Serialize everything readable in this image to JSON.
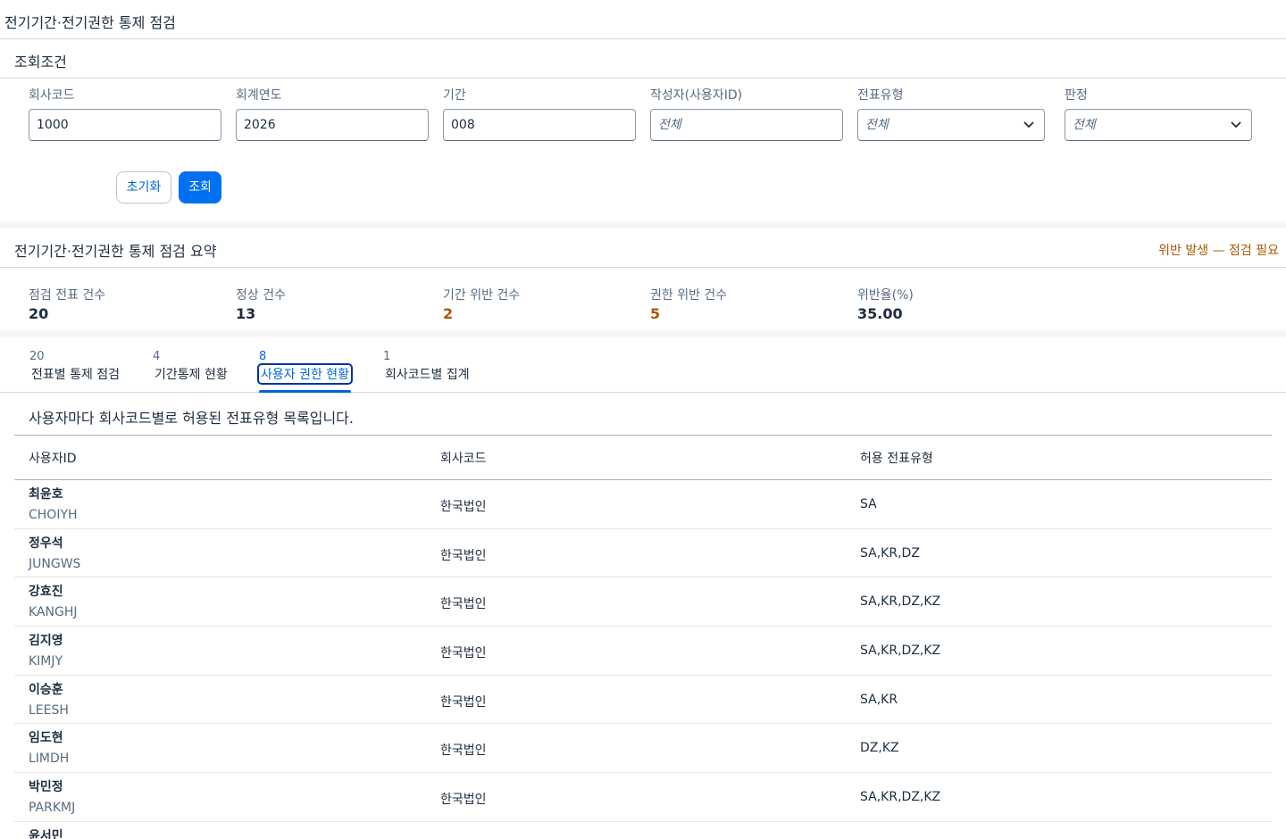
{
  "page": {
    "title": "전기기간·전기권한 통제 점검"
  },
  "filter": {
    "title": "조회조건",
    "fields": [
      {
        "label": "회사코드",
        "value": "1000"
      },
      {
        "label": "회계연도",
        "value": "2026"
      },
      {
        "label": "기간",
        "value": "008"
      },
      {
        "label": "작성자(사용자ID)",
        "placeholder": "전체"
      },
      {
        "label": "전표유형",
        "placeholder": "전체"
      },
      {
        "label": "판정",
        "placeholder": "전체"
      }
    ],
    "reset_label": "초기화",
    "search_label": "조회"
  },
  "summary": {
    "title": "전기기간·전기권한 통제 점검 요약",
    "status": "위반 발생 — 점검 필요",
    "status_color": "#aa5808",
    "kpis": [
      {
        "label": "점검 전표 건수",
        "value": "20"
      },
      {
        "label": "정상 건수",
        "value": "13"
      },
      {
        "label": "기간 위반 건수",
        "value": "2"
      },
      {
        "label": "권한 위반 건수",
        "value": "5"
      },
      {
        "label": "위반율(%)",
        "value": "35.00"
      }
    ]
  },
  "tabs": [
    {
      "count": "20",
      "label": "전표별 통제 점검"
    },
    {
      "count": "4",
      "label": "기간통제 현황"
    },
    {
      "count": "8",
      "label": "사용자 권한 현황"
    },
    {
      "count": "1",
      "label": "회사코드별 집계"
    }
  ],
  "active_tab": 2,
  "user_auth": {
    "description": "사용자마다 회사코드별로 허용된 전표유형 목록입니다.",
    "columns": [
      "사용자ID",
      "회사코드",
      "허용 전표유형"
    ],
    "rows": [
      {
        "name": "최윤호",
        "id": "CHOIYH",
        "company": "한국법인",
        "types": "SA"
      },
      {
        "name": "정우석",
        "id": "JUNGWS",
        "company": "한국법인",
        "types": "SA,KR,DZ"
      },
      {
        "name": "강효진",
        "id": "KANGHJ",
        "company": "한국법인",
        "types": "SA,KR,DZ,KZ"
      },
      {
        "name": "김지영",
        "id": "KIMJY",
        "company": "한국법인",
        "types": "SA,KR,DZ,KZ"
      },
      {
        "name": "이승훈",
        "id": "LEESH",
        "company": "한국법인",
        "types": "SA,KR"
      },
      {
        "name": "임도현",
        "id": "LIMDH",
        "company": "한국법인",
        "types": "DZ,KZ"
      },
      {
        "name": "박민정",
        "id": "PARKMJ",
        "company": "한국법인",
        "types": "SA,KR,DZ,KZ"
      },
      {
        "name": "윤서민",
        "id": "",
        "company": "",
        "types": ""
      }
    ]
  }
}
